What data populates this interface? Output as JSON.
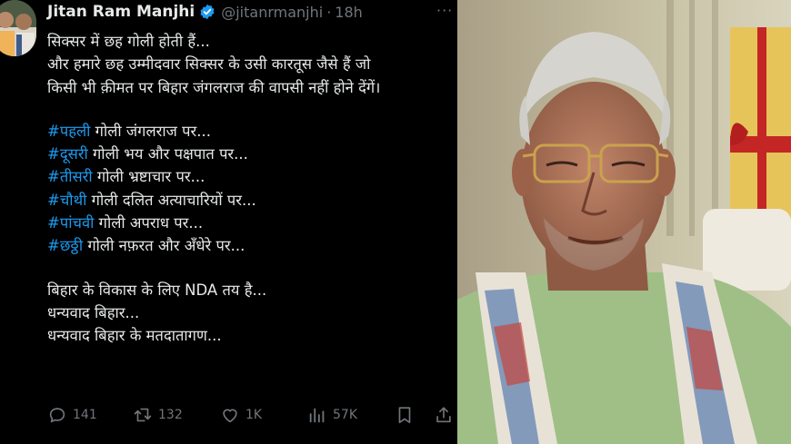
{
  "tweet": {
    "author_name": "Jitan Ram Manjhi",
    "handle": "@jitanrmanjhi",
    "separator": "·",
    "time": "18h",
    "more": "···",
    "lines": [
      {
        "tag": "",
        "text": "सिक्सर में छह गोली होती हैं..."
      },
      {
        "tag": "",
        "text": "और हमारे छह उम्मीदवार सिक्सर के उसी कारतूस जैसे हैं जो"
      },
      {
        "tag": "",
        "text": "किसी भी क़ीमत पर बिहार जंगलराज की वापसी नहीं होने देंगें।"
      }
    ],
    "hashtag_lines": [
      {
        "tag": "#पहली",
        "text": " गोली जंगलराज पर..."
      },
      {
        "tag": "#दूसरी",
        "text": " गोली भय और पक्षपात पर..."
      },
      {
        "tag": "#तीसरी",
        "text": " गोली भ्रष्टाचार पर..."
      },
      {
        "tag": "#चौथी",
        "text": " गोली दलित अत्याचारियों पर..."
      },
      {
        "tag": "#पांचवी",
        "text": " गोली अपराध पर..."
      },
      {
        "tag": "#छठ्ठी",
        "text": " गोली नफ़रत और अँधेरे पर..."
      }
    ],
    "closing_lines": [
      {
        "text": "बिहार के विकास के लिए NDA तय है..."
      },
      {
        "text": "धन्यवाद बिहार..."
      },
      {
        "text": "धन्यवाद बिहार के मतदातागण..."
      }
    ],
    "actions": {
      "replies": "141",
      "reposts": "132",
      "likes": "1K",
      "views": "57K"
    },
    "icons": [
      "verified-badge-icon",
      "more-icon",
      "reply-icon",
      "repost-icon",
      "like-icon",
      "views-icon",
      "bookmark-icon",
      "share-icon"
    ],
    "colors": {
      "background": "#000000",
      "text": "#e7e9ea",
      "muted": "#71767b",
      "hashtag": "#1d9bf0",
      "verified": "#1d9bf0"
    }
  }
}
